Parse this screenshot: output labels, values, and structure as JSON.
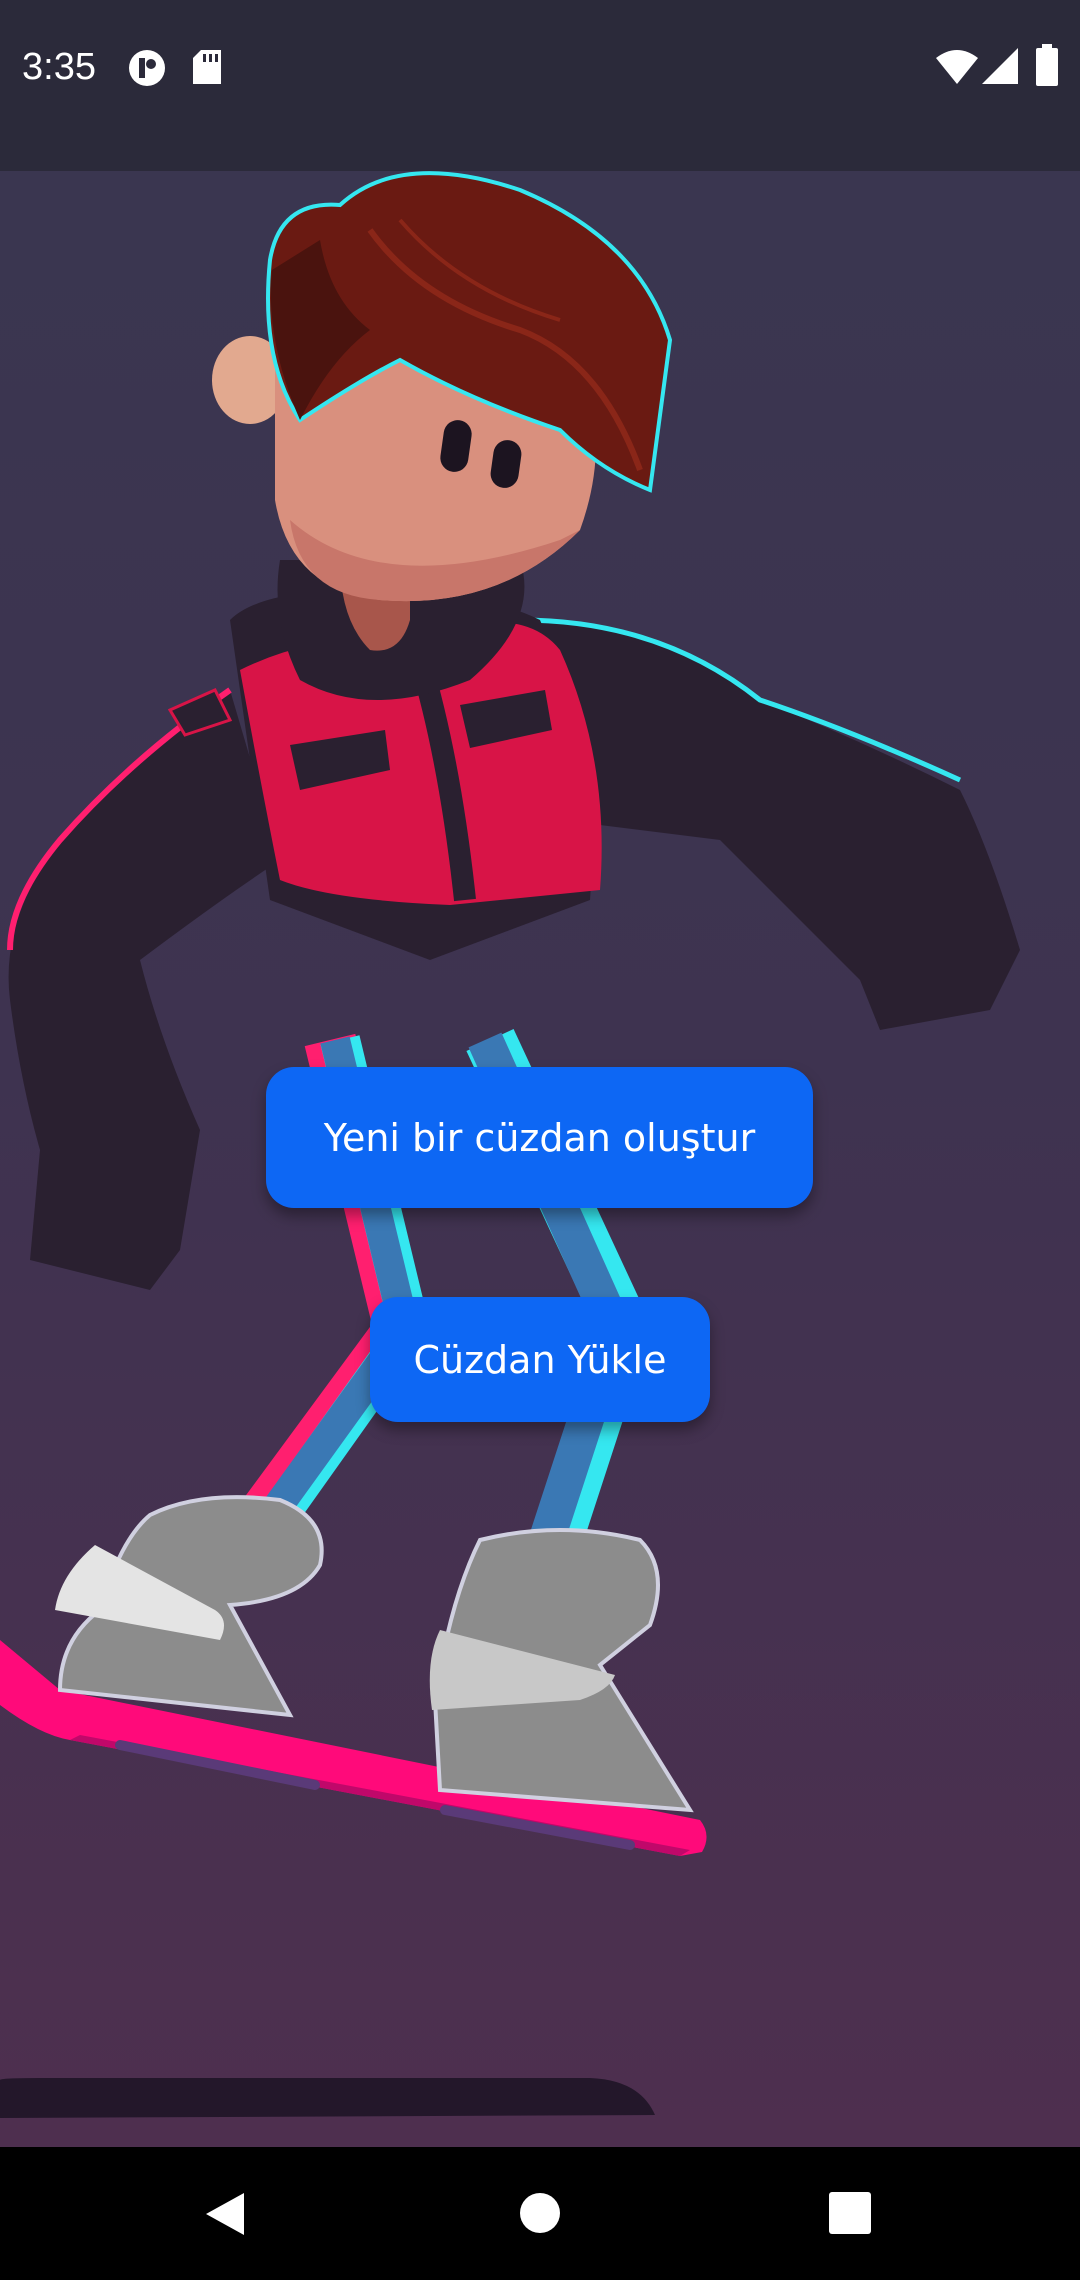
{
  "status_bar": {
    "time": "3:35",
    "left_icons": [
      "app-notification-icon",
      "sd-card-icon"
    ],
    "right_icons": [
      "wifi-icon",
      "signal-icon",
      "battery-icon"
    ]
  },
  "actions": {
    "create_wallet_label": "Yeni bir cüzdan oluştur",
    "load_wallet_label": "Cüzdan Yükle"
  },
  "illustration": {
    "subject": "hoverboard-skater-character",
    "colors": {
      "vest": "#d81447",
      "hair": "#6a1a12",
      "skin": "#d9907e",
      "jacket": "#2a2030",
      "board": "#ff0a7a",
      "boots": "#8a8a8a",
      "legs": "#3a78b4",
      "neon_cyan": "#35e7f0",
      "neon_pink": "#ff1f6f"
    }
  },
  "nav_bar": {
    "items": [
      "back-icon",
      "home-icon",
      "recents-icon"
    ]
  },
  "colors": {
    "primary_button": "#0d67f4",
    "status_bar_bg": "#2b2a3a",
    "nav_bar_bg": "#000000"
  }
}
